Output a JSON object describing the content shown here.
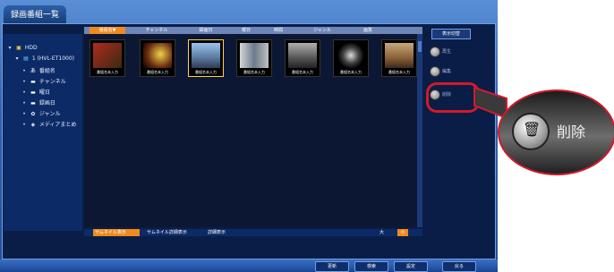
{
  "window": {
    "title": "録画番組一覧"
  },
  "columns": [
    {
      "label": "番組名▼",
      "active": true
    },
    {
      "label": "チャンネル",
      "active": false
    },
    {
      "label": "録画日",
      "active": false
    },
    {
      "label": "曜日",
      "active": false
    },
    {
      "label": "時間",
      "active": false
    },
    {
      "label": "ジャンル",
      "active": false
    },
    {
      "label": "画質",
      "active": false
    }
  ],
  "tree": [
    {
      "label": "HDD",
      "icon": "folder-icon"
    },
    {
      "label": "1 (HVL-ET1000)",
      "icon": "drive-icon"
    },
    {
      "label": "番組名",
      "icon": "text-icon"
    },
    {
      "label": "チャンネル",
      "icon": "tv-icon"
    },
    {
      "label": "曜日",
      "icon": "tv-icon"
    },
    {
      "label": "録画日",
      "icon": "tv-icon"
    },
    {
      "label": "ジャンル",
      "icon": "genre-icon"
    },
    {
      "label": "メディアまとめ",
      "icon": "media-icon"
    }
  ],
  "thumbnails": [
    {
      "label": "番組名未入力",
      "selected": false,
      "color": "#b02a20"
    },
    {
      "label": "番組名未入力",
      "selected": false,
      "color": "#c7b33a"
    },
    {
      "label": "番組名未入力",
      "selected": true,
      "color": "#6f8fb8"
    },
    {
      "label": "番組名未入力",
      "selected": false,
      "color": "#8aa08a"
    },
    {
      "label": "番組名未入力",
      "selected": false,
      "color": "#7c7c7c"
    },
    {
      "label": "番組名未入力",
      "selected": false,
      "color": "#3f4f4f"
    },
    {
      "label": "番組名未入力",
      "selected": false,
      "color": "#c48a4a"
    }
  ],
  "right_toolbar": {
    "display_switch_label": "表示切替",
    "side_buttons": [
      "再生",
      "編集",
      "削除"
    ]
  },
  "bottom_tabs": [
    {
      "label": "サムネイル表示",
      "active": true
    },
    {
      "label": "サムネイル詳細表示",
      "active": false
    },
    {
      "label": "詳細表示",
      "active": false
    }
  ],
  "bottom_size": {
    "large": "大",
    "small": "小"
  },
  "footer_buttons": [
    "更新",
    "検索",
    "設定",
    "戻る"
  ],
  "zoom": {
    "label": "削除",
    "icon": "trash-icon"
  },
  "colors": {
    "accent": "#f08a1c",
    "highlight": "#d11a2a"
  }
}
